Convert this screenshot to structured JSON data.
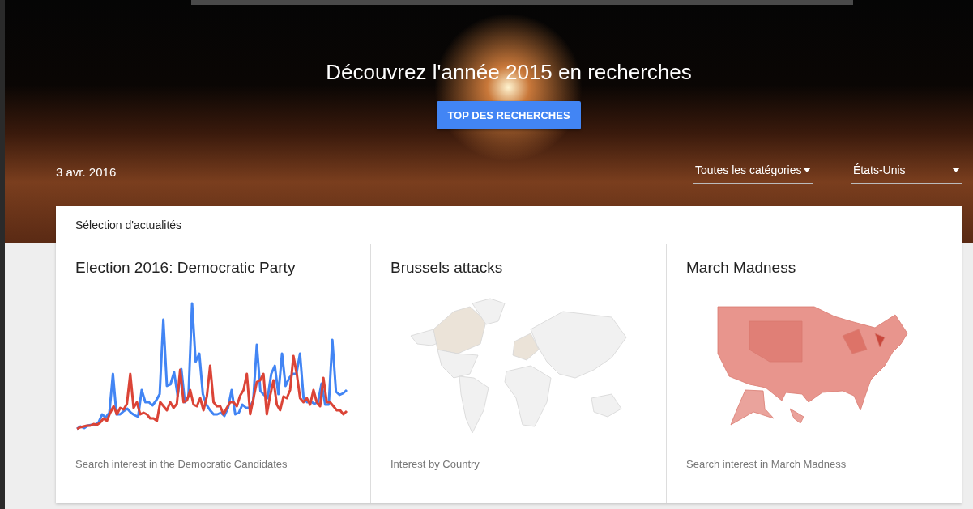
{
  "hero": {
    "title": "Découvrez l'année 2015 en recherches",
    "button": "TOP DES RECHERCHES",
    "date": "3 avr. 2016",
    "filters": [
      {
        "label": "Toutes les catégories"
      },
      {
        "label": "États-Unis"
      }
    ]
  },
  "section": {
    "title": "Sélection d'actualités",
    "stories": [
      {
        "kind": "line_chart",
        "title": "Election 2016: Democratic Party",
        "caption": "Search interest in the Democratic Candidates"
      },
      {
        "kind": "world_map",
        "title": "Brussels attacks",
        "caption": "Interest by Country"
      },
      {
        "kind": "us_map",
        "title": "March Madness",
        "caption": "Search interest in March Madness"
      }
    ]
  }
}
